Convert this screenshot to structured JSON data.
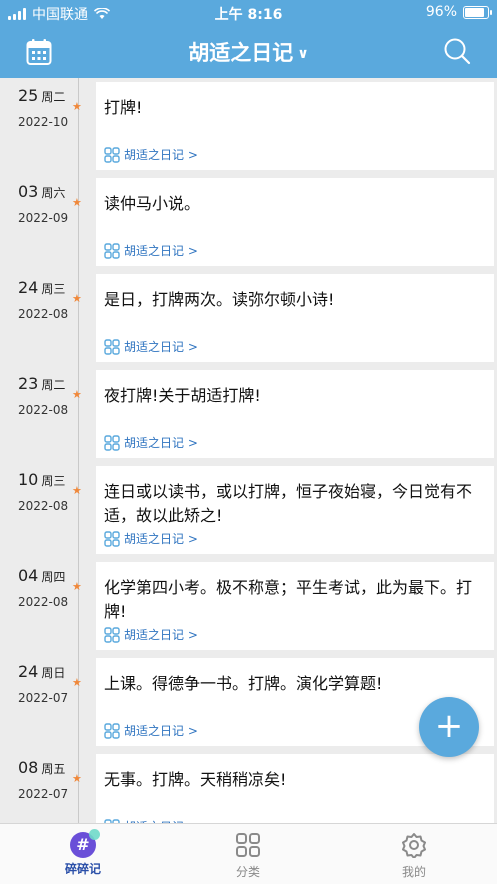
{
  "status_bar": {
    "carrier": "中国联通",
    "time": "上午 8:16",
    "battery": "96%",
    "battery_level": 0.96
  },
  "nav": {
    "title": "胡适之日记",
    "chevron": "∨"
  },
  "entries": [
    {
      "day": "25",
      "weekday": "周二",
      "year_month": "2022-10",
      "text": "打牌!",
      "source": "胡适之日记 >"
    },
    {
      "day": "03",
      "weekday": "周六",
      "year_month": "2022-09",
      "text": "读仲马小说。",
      "source": "胡适之日记 >"
    },
    {
      "day": "24",
      "weekday": "周三",
      "year_month": "2022-08",
      "text": "是日，打牌两次。读弥尔顿小诗!",
      "source": "胡适之日记 >"
    },
    {
      "day": "23",
      "weekday": "周二",
      "year_month": "2022-08",
      "text": "夜打牌!关于胡适打牌!",
      "source": "胡适之日记 >"
    },
    {
      "day": "10",
      "weekday": "周三",
      "year_month": "2022-08",
      "text": "连日或以读书，或以打牌，恒子夜始寝，今日觉有不适，故以此矫之!",
      "source": "胡适之日记 >"
    },
    {
      "day": "04",
      "weekday": "周四",
      "year_month": "2022-08",
      "text": "化学第四小考。极不称意；平生考试，此为最下。打牌!",
      "source": "胡适之日记 >"
    },
    {
      "day": "24",
      "weekday": "周日",
      "year_month": "2022-07",
      "text": "上课。得德争一书。打牌。演化学算题!",
      "source": "胡适之日记 >"
    },
    {
      "day": "08",
      "weekday": "周五",
      "year_month": "2022-07",
      "text": "无事。打牌。天稍稍凉矣!",
      "source": "胡适之日记 >"
    }
  ],
  "fab": {
    "label": "+"
  },
  "tabs": [
    {
      "label": "碎碎记",
      "icon": "hash-bubble-icon",
      "active": true
    },
    {
      "label": "分类",
      "icon": "grid-icon",
      "active": false
    },
    {
      "label": "我的",
      "icon": "gear-icon",
      "active": false
    }
  ],
  "colors": {
    "brand": "#5aa9dd",
    "star": "#f0883a",
    "link": "#2f74c0",
    "active_tab": "#2a4fa8"
  }
}
